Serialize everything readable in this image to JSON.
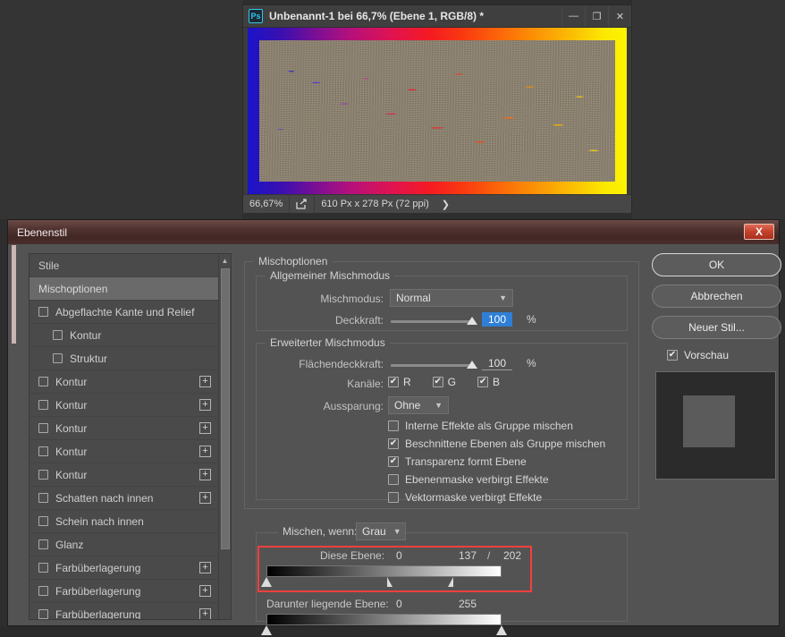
{
  "photoshop_window": {
    "logo": "Ps",
    "title": "Unbenannt-1 bei 66,7% (Ebene 1, RGB/8) *",
    "controls": {
      "minimize": "—",
      "maximize": "❐",
      "close": "✕"
    },
    "status_bar": {
      "zoom": "66,67%",
      "share_icon": "share-icon",
      "dimensions": "610 Px x 278 Px (72 ppi)",
      "expand": "❯"
    }
  },
  "dialog": {
    "title": "Ebenenstil",
    "close_label": "X",
    "sidebar": {
      "header": "Stile",
      "selected": "Mischoptionen",
      "items": [
        {
          "label": "Stile",
          "type": "header",
          "checkbox": false,
          "plus": false,
          "indent": false,
          "selected": false
        },
        {
          "label": "Mischoptionen",
          "type": "item",
          "checkbox": false,
          "plus": false,
          "indent": false,
          "selected": true
        },
        {
          "label": "Abgeflachte Kante und Relief",
          "type": "item",
          "checkbox": true,
          "checked": false,
          "plus": false,
          "indent": false,
          "selected": false
        },
        {
          "label": "Kontur",
          "type": "item",
          "checkbox": true,
          "checked": false,
          "plus": false,
          "indent": true,
          "selected": false
        },
        {
          "label": "Struktur",
          "type": "item",
          "checkbox": true,
          "checked": false,
          "plus": false,
          "indent": true,
          "selected": false
        },
        {
          "label": "Kontur",
          "type": "item",
          "checkbox": true,
          "checked": false,
          "plus": true,
          "indent": false,
          "selected": false
        },
        {
          "label": "Kontur",
          "type": "item",
          "checkbox": true,
          "checked": false,
          "plus": true,
          "indent": false,
          "selected": false
        },
        {
          "label": "Kontur",
          "type": "item",
          "checkbox": true,
          "checked": false,
          "plus": true,
          "indent": false,
          "selected": false
        },
        {
          "label": "Kontur",
          "type": "item",
          "checkbox": true,
          "checked": false,
          "plus": true,
          "indent": false,
          "selected": false
        },
        {
          "label": "Kontur",
          "type": "item",
          "checkbox": true,
          "checked": false,
          "plus": true,
          "indent": false,
          "selected": false
        },
        {
          "label": "Schatten nach innen",
          "type": "item",
          "checkbox": true,
          "checked": false,
          "plus": true,
          "indent": false,
          "selected": false
        },
        {
          "label": "Schein nach innen",
          "type": "item",
          "checkbox": true,
          "checked": false,
          "plus": false,
          "indent": false,
          "selected": false
        },
        {
          "label": "Glanz",
          "type": "item",
          "checkbox": true,
          "checked": false,
          "plus": false,
          "indent": false,
          "selected": false
        },
        {
          "label": "Farbüberlagerung",
          "type": "item",
          "checkbox": true,
          "checked": false,
          "plus": true,
          "indent": false,
          "selected": false
        },
        {
          "label": "Farbüberlagerung",
          "type": "item",
          "checkbox": true,
          "checked": false,
          "plus": true,
          "indent": false,
          "selected": false
        },
        {
          "label": "Farbüberlagerung",
          "type": "item",
          "checkbox": true,
          "checked": false,
          "plus": true,
          "indent": false,
          "selected": false
        }
      ],
      "scroll_up_icon": "chevron-up-icon"
    },
    "main": {
      "section_title": "Mischoptionen",
      "general_group": {
        "title": "Allgemeiner Mischmodus",
        "blend_mode_label": "Mischmodus:",
        "blend_mode_value": "Normal",
        "opacity_label": "Deckkraft:",
        "opacity_value": "100",
        "opacity_unit": "%"
      },
      "advanced_group": {
        "title": "Erweiterter Mischmodus",
        "fill_label": "Flächendeckkraft:",
        "fill_value": "100",
        "fill_unit": "%",
        "channels_label": "Kanäle:",
        "channels": [
          {
            "label": "R",
            "checked": true
          },
          {
            "label": "G",
            "checked": true
          },
          {
            "label": "B",
            "checked": true
          }
        ],
        "knockout_label": "Aussparung:",
        "knockout_value": "Ohne",
        "options": [
          {
            "label": "Interne Effekte als Gruppe mischen",
            "checked": false
          },
          {
            "label": "Beschnittene Ebenen als Gruppe mischen",
            "checked": true
          },
          {
            "label": "Transparenz formt Ebene",
            "checked": true
          },
          {
            "label": "Ebenenmaske verbirgt Effekte",
            "checked": false
          },
          {
            "label": "Vektormaske verbirgt Effekte",
            "checked": false
          }
        ]
      },
      "blend_if_group": {
        "title": "Mischen, wenn:",
        "channel_value": "Grau",
        "this_layer": {
          "label": "Diese Ebene:",
          "black_value": "0",
          "white_value_low": "137",
          "separator": "/",
          "white_value_high": "202"
        },
        "underlying_layer": {
          "label": "Darunter liegende Ebene:",
          "black_value": "0",
          "white_value": "255"
        },
        "highlight_color": "#f4403c"
      }
    },
    "buttons": {
      "ok": "OK",
      "cancel": "Abbrechen",
      "new_style": "Neuer Stil...",
      "preview_label": "Vorschau",
      "preview_checked": true
    }
  },
  "chart_data": null
}
